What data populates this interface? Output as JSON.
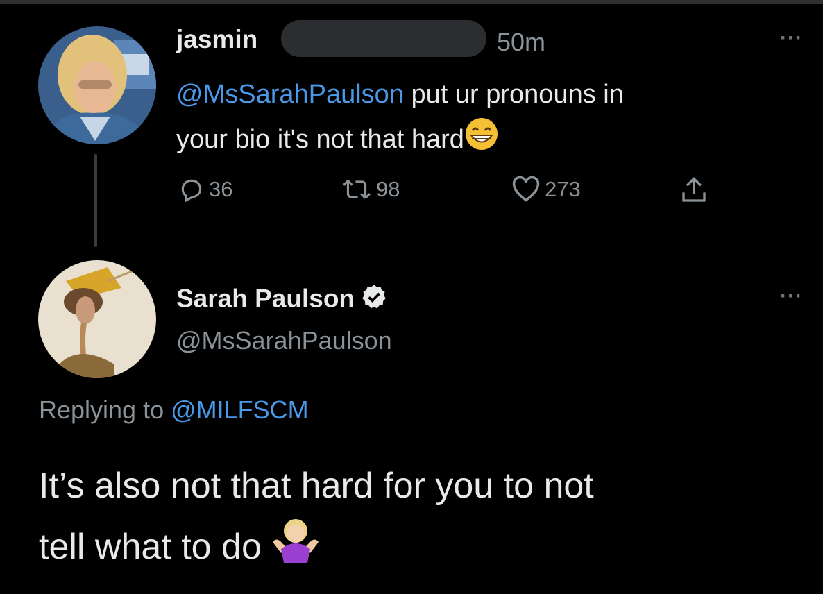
{
  "tweet": {
    "author_name": "jasmin",
    "time": "50m",
    "mention": "@MsSarahPaulson",
    "text_line1": " put ur pronouns in",
    "text_line2": "your bio it's not that hard",
    "emoji": "grinning-face",
    "stats": {
      "replies": "36",
      "retweets": "98",
      "likes": "273"
    },
    "more_label": "···"
  },
  "reply": {
    "author_name": "Sarah Paulson",
    "handle": "@MsSarahPaulson",
    "verified": true,
    "replying_prefix": "Replying to ",
    "replying_handle": "@MILFSCM",
    "text_line1": "It’s also not that hard for you to not",
    "text_line2": "tell what to do",
    "emoji": "person-shrugging",
    "more_label": "···"
  },
  "colors": {
    "background": "#000000",
    "text": "#e7e9ea",
    "muted": "#8b9298",
    "link": "#4a99e9"
  }
}
